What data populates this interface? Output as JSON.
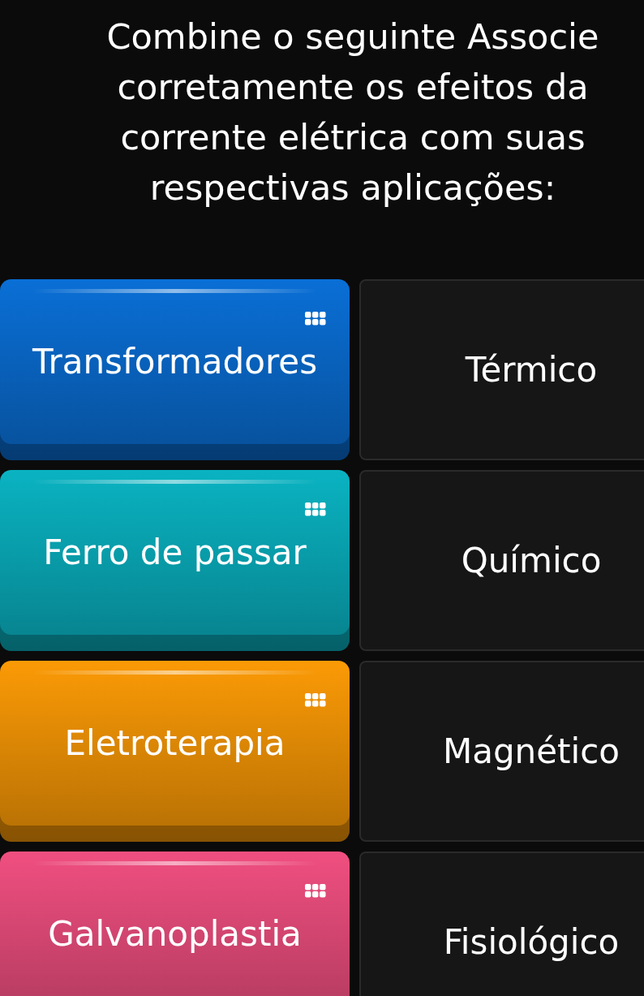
{
  "question": {
    "title": "Combine o seguinte Associe corretamente os efeitos da corrente elétrica com suas respectivas aplicações:"
  },
  "pairs": [
    {
      "item": {
        "label": "Transformadores",
        "color": "#0a6fd6"
      },
      "target": {
        "label": "Térmico"
      }
    },
    {
      "item": {
        "label": "Ferro de passar",
        "color": "#0ab3c2"
      },
      "target": {
        "label": "Químico"
      }
    },
    {
      "item": {
        "label": "Eletroterapia",
        "color": "#fb9a06"
      },
      "target": {
        "label": "Magnético"
      }
    },
    {
      "item": {
        "label": "Galvanoplastia",
        "color": "#f04f80"
      },
      "target": {
        "label": "Fisiológico"
      }
    }
  ]
}
